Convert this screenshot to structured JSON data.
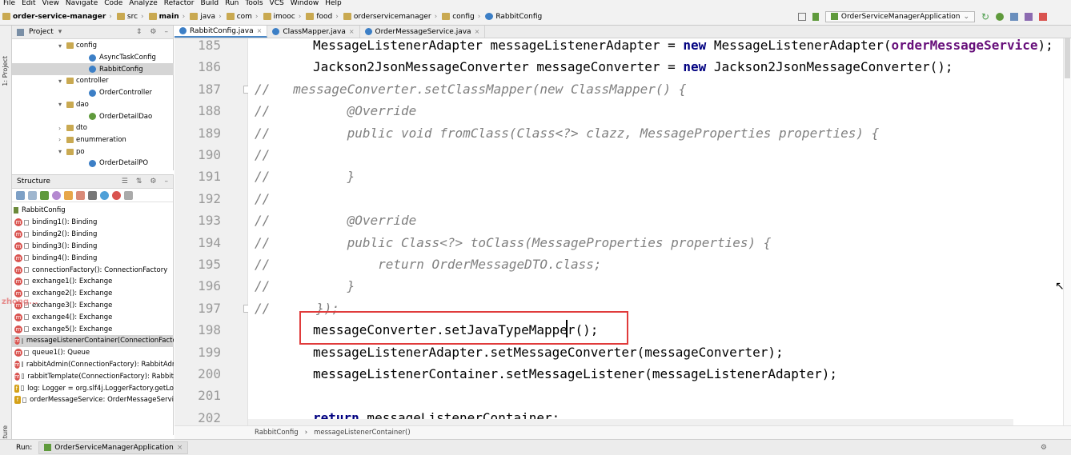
{
  "menu": [
    "File",
    "Edit",
    "View",
    "Navigate",
    "Code",
    "Analyze",
    "Refactor",
    "Build",
    "Run",
    "Tools",
    "VCS",
    "Window",
    "Help"
  ],
  "breadcrumbs": [
    "order-service-manager",
    "src",
    "main",
    "java",
    "com",
    "imooc",
    "food",
    "orderservicemanager",
    "config",
    "RabbitConfig"
  ],
  "run_config": "OrderServiceManagerApplication",
  "project_panel": {
    "title": "Project"
  },
  "project_tree": [
    {
      "label": "config",
      "indent": 1,
      "type": "folder",
      "arrow": "▾"
    },
    {
      "label": "AsyncTaskConfig",
      "indent": 2,
      "type": "class",
      "arrow": ""
    },
    {
      "label": "RabbitConfig",
      "indent": 2,
      "type": "class",
      "arrow": "",
      "selected": true
    },
    {
      "label": "controller",
      "indent": 1,
      "type": "folder",
      "arrow": "▾"
    },
    {
      "label": "OrderController",
      "indent": 2,
      "type": "class",
      "arrow": ""
    },
    {
      "label": "dao",
      "indent": 1,
      "type": "folder",
      "arrow": "▾"
    },
    {
      "label": "OrderDetailDao",
      "indent": 2,
      "type": "iface",
      "arrow": ""
    },
    {
      "label": "dto",
      "indent": 1,
      "type": "folder",
      "arrow": "›"
    },
    {
      "label": "enummeration",
      "indent": 1,
      "type": "folder",
      "arrow": "›"
    },
    {
      "label": "po",
      "indent": 1,
      "type": "folder",
      "arrow": "▾"
    },
    {
      "label": "OrderDetailPO",
      "indent": 2,
      "type": "class",
      "arrow": ""
    }
  ],
  "structure_panel": {
    "title": "Structure",
    "root": "RabbitConfig"
  },
  "structure_items": [
    {
      "label": "binding1(): Binding",
      "kind": "m"
    },
    {
      "label": "binding2(): Binding",
      "kind": "m"
    },
    {
      "label": "binding3(): Binding",
      "kind": "m"
    },
    {
      "label": "binding4(): Binding",
      "kind": "m"
    },
    {
      "label": "connectionFactory(): ConnectionFactory",
      "kind": "m"
    },
    {
      "label": "exchange1(): Exchange",
      "kind": "m"
    },
    {
      "label": "exchange2(): Exchange",
      "kind": "m"
    },
    {
      "label": "exchange3(): Exchange",
      "kind": "m"
    },
    {
      "label": "exchange4(): Exchange",
      "kind": "m"
    },
    {
      "label": "exchange5(): Exchange",
      "kind": "m"
    },
    {
      "label": "messageListenerContainer(ConnectionFactory",
      "kind": "m",
      "selected": true
    },
    {
      "label": "queue1(): Queue",
      "kind": "m"
    },
    {
      "label": "rabbitAdmin(ConnectionFactory): RabbitAdm",
      "kind": "m"
    },
    {
      "label": "rabbitTemplate(ConnectionFactory): Rabbit",
      "kind": "m"
    },
    {
      "label": "log: Logger = org.slf4j.LoggerFactory.getLo",
      "kind": "f"
    },
    {
      "label": "orderMessageService: OrderMessageServi",
      "kind": "f"
    }
  ],
  "watermark": "zhong...",
  "tabs": [
    {
      "label": "RabbitConfig.java",
      "active": true
    },
    {
      "label": "ClassMapper.java",
      "active": false
    },
    {
      "label": "OrderMessageService.java",
      "active": false
    }
  ],
  "line_numbers": [
    "185",
    "186",
    "187",
    "188",
    "189",
    "190",
    "191",
    "192",
    "193",
    "194",
    "195",
    "196",
    "197",
    "198",
    "199",
    "200",
    "201",
    "202"
  ],
  "code_lines": [
    {
      "indent": "    ",
      "parts": [
        {
          "t": "MessageListenerAdapter messageListenerAdapter = ",
          "c": ""
        },
        {
          "t": "new",
          "c": "kw"
        },
        {
          "t": " MessageListenerAdapter(",
          "c": ""
        },
        {
          "t": "orderMessageService",
          "c": "fld"
        },
        {
          "t": ");",
          "c": ""
        }
      ]
    },
    {
      "indent": "    ",
      "parts": [
        {
          "t": "Jackson2JsonMessageConverter messageConverter = ",
          "c": ""
        },
        {
          "t": "new",
          "c": "kw"
        },
        {
          "t": " Jackson2JsonMessageConverter();",
          "c": ""
        }
      ]
    },
    {
      "indent": "",
      "parts": [
        {
          "t": "//   messageConverter.setClassMapper(new ClassMapper() {",
          "c": "cm"
        }
      ]
    },
    {
      "indent": "",
      "parts": [
        {
          "t": "//          @Override",
          "c": "cm"
        }
      ]
    },
    {
      "indent": "",
      "parts": [
        {
          "t": "//          public void fromClass(Class<?> clazz, MessageProperties properties) {",
          "c": "cm"
        }
      ]
    },
    {
      "indent": "",
      "parts": [
        {
          "t": "//",
          "c": "cm"
        }
      ]
    },
    {
      "indent": "",
      "parts": [
        {
          "t": "//          }",
          "c": "cm"
        }
      ]
    },
    {
      "indent": "",
      "parts": [
        {
          "t": "//",
          "c": "cm"
        }
      ]
    },
    {
      "indent": "",
      "parts": [
        {
          "t": "//          @Override",
          "c": "cm"
        }
      ]
    },
    {
      "indent": "",
      "parts": [
        {
          "t": "//          public Class<?> toClass(MessageProperties properties) {",
          "c": "cm"
        }
      ]
    },
    {
      "indent": "",
      "parts": [
        {
          "t": "//              return OrderMessageDTO.class;",
          "c": "cm"
        }
      ]
    },
    {
      "indent": "",
      "parts": [
        {
          "t": "//          }",
          "c": "cm"
        }
      ]
    },
    {
      "indent": "",
      "parts": [
        {
          "t": "//      });",
          "c": "cm"
        }
      ]
    },
    {
      "indent": "    ",
      "parts": [
        {
          "t": "messageConverter.setJavaTypeMapper();",
          "c": ""
        }
      ]
    },
    {
      "indent": "    ",
      "parts": [
        {
          "t": "messageListenerAdapter.setMessageConverter(messageConverter);",
          "c": ""
        }
      ]
    },
    {
      "indent": "    ",
      "parts": [
        {
          "t": "messageListenerContainer.setMessageListener(messageListenerAdapter);",
          "c": ""
        }
      ]
    },
    {
      "indent": "",
      "parts": [
        {
          "t": "",
          "c": ""
        }
      ]
    },
    {
      "indent": "    ",
      "parts": [
        {
          "t": "return",
          "c": "kw"
        },
        {
          "t": " messageListenerContainer;",
          "c": ""
        }
      ]
    }
  ],
  "editor_crumbs": [
    "RabbitConfig",
    "messageListenerContainer()"
  ],
  "run_bar": {
    "label": "Run:",
    "app": "OrderServiceManagerApplication"
  },
  "side_labels": {
    "project": "1: Project",
    "structure": "Structure"
  }
}
